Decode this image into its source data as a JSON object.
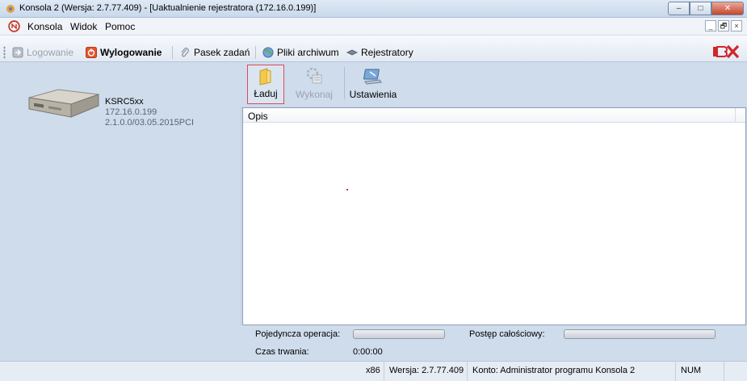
{
  "window": {
    "title": "Konsola 2 (Wersja:  2.7.77.409) - [Uaktualnienie rejestratora (172.16.0.199)]",
    "minimize_label": "–",
    "maximize_label": "□",
    "close_label": "✕"
  },
  "menu": {
    "items": [
      "Konsola",
      "Widok",
      "Pomoc"
    ],
    "mdi": [
      "_",
      "🗗",
      "×"
    ]
  },
  "toolbar": {
    "login": "Logowanie",
    "logout": "Wylogowanie",
    "taskbar": "Pasek zadań",
    "archive": "Pliki archiwum",
    "recorders": "Rejestratory",
    "brand": "BX"
  },
  "device": {
    "name": "KSRC5xx",
    "ip": "172.16.0.199",
    "version": "2.1.0.0/03.05.2015PCI"
  },
  "actions": {
    "load": "Ładuj",
    "execute": "Wykonaj",
    "settings": "Ustawienia"
  },
  "list": {
    "column": "Opis"
  },
  "progress": {
    "single_label": "Pojedyncza operacja:",
    "total_label": "Postęp całościowy:",
    "duration_label": "Czas trwania:",
    "duration_value": "0:00:00"
  },
  "status": {
    "arch": "x86",
    "version": "Wersja: 2.7.77.409",
    "account": "Konto: Administrator programu Konsola 2",
    "num": "NUM"
  },
  "colors": {
    "accent_border": "#d84a5a",
    "panel_bg": "#cfdcec"
  }
}
